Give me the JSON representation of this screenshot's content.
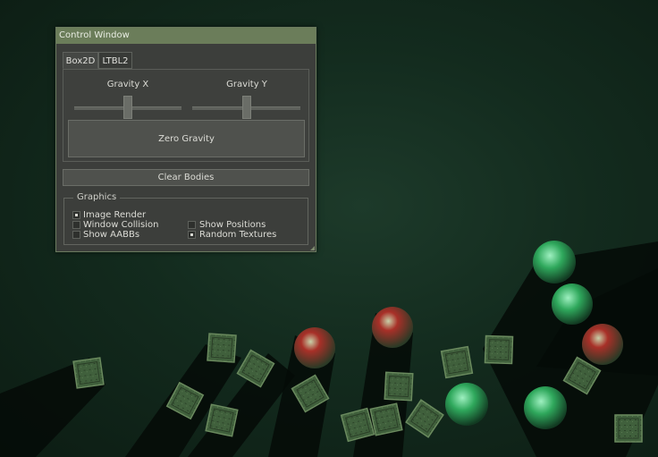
{
  "window": {
    "title": "Control Window",
    "tabs": [
      "Box2D",
      "LTBL2"
    ],
    "active_tab": "Box2D",
    "sliders": [
      {
        "label": "Gravity X",
        "value": 0.5
      },
      {
        "label": "Gravity Y",
        "value": 0.5
      }
    ],
    "zero_gravity_label": "Zero Gravity",
    "clear_bodies_label": "Clear Bodies",
    "graphics": {
      "legend": "Graphics",
      "options": [
        {
          "label": "Image Render",
          "checked": true
        },
        {
          "label": "Window Collision",
          "checked": false
        },
        {
          "label": "Show AABBs",
          "checked": false
        },
        {
          "label": "Show Positions",
          "checked": false
        },
        {
          "label": "Random Textures",
          "checked": true
        }
      ]
    }
  },
  "colors": {
    "background": "#132b1e",
    "crate": "#3e5a3a",
    "ball_red": "#a02a24",
    "ball_green": "#3aa861"
  },
  "scene_objects": {
    "shadow_count": 7,
    "crates": [
      {
        "id": "crate"
      },
      {
        "id": "crate"
      },
      {
        "id": "crate"
      },
      {
        "id": "crate"
      },
      {
        "id": "crate"
      },
      {
        "id": "crate"
      },
      {
        "id": "crate"
      },
      {
        "id": "crate"
      },
      {
        "id": "crate"
      },
      {
        "id": "crate"
      },
      {
        "id": "crate"
      },
      {
        "id": "crate"
      },
      {
        "id": "crate"
      },
      {
        "id": "crate"
      }
    ],
    "balls": [
      {
        "color": "red"
      },
      {
        "color": "red"
      },
      {
        "color": "red"
      },
      {
        "color": "green"
      },
      {
        "color": "green"
      },
      {
        "color": "green"
      },
      {
        "color": "green"
      }
    ]
  }
}
